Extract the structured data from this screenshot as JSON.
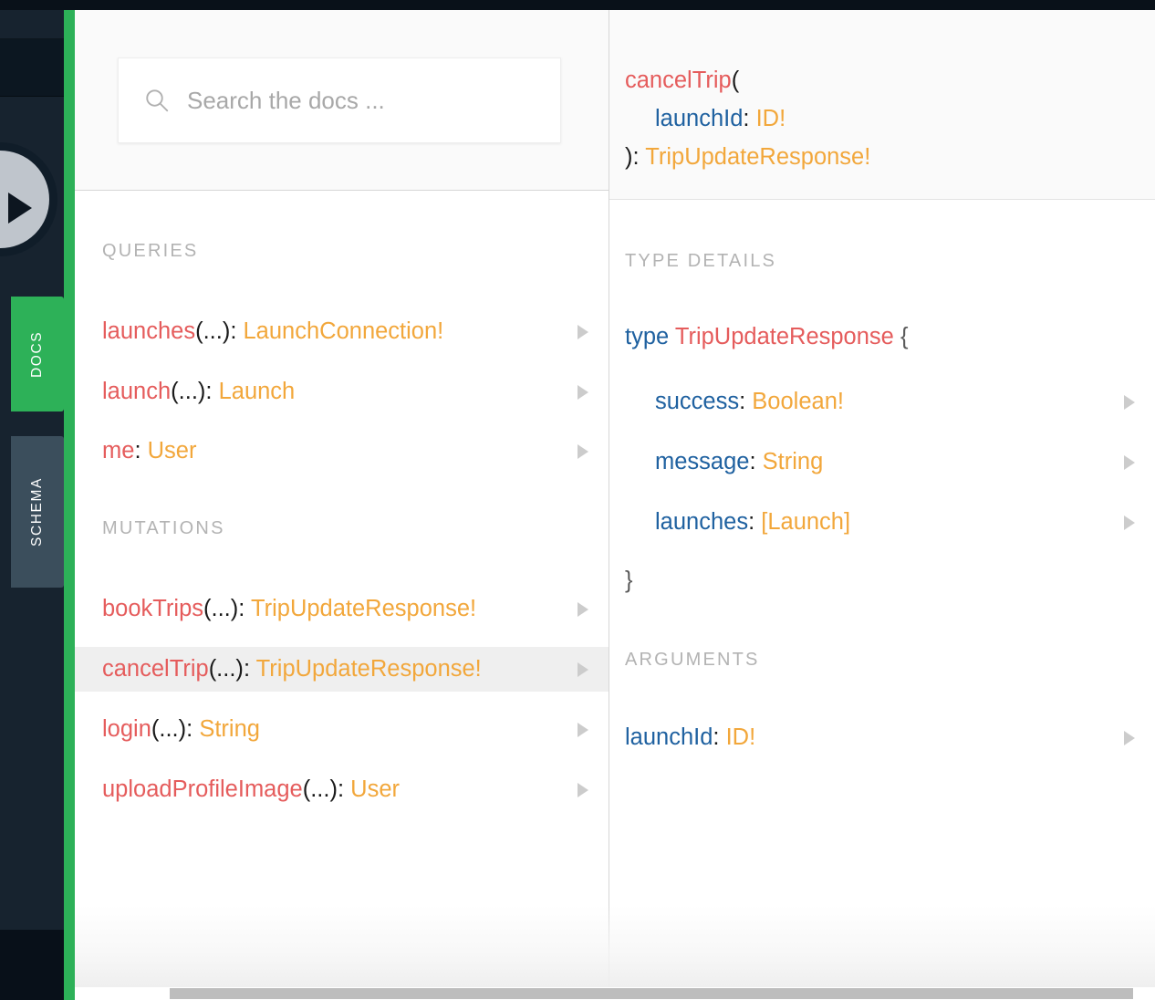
{
  "window": {
    "accent_green": "#2db158",
    "rail_dark": "#17232f",
    "selected_row_bg": "#efefef",
    "field_color": "#e55c5c",
    "type_color": "#f2a73b",
    "arg_color": "#1f61a0"
  },
  "rail": {
    "tabs": [
      {
        "label": "DOCS",
        "active": true
      },
      {
        "label": "SCHEMA",
        "active": false
      }
    ],
    "play_button_label": "play-query"
  },
  "search": {
    "placeholder": "Search the docs ...",
    "value": "",
    "icon": "search-icon"
  },
  "left_panel": {
    "sections": [
      {
        "title": "QUERIES",
        "items": [
          {
            "name": "launches",
            "args": "(...)",
            "sep": ": ",
            "type": "LaunchConnection!",
            "selected": false,
            "caret": true
          },
          {
            "name": "launch",
            "args": "(...)",
            "sep": ": ",
            "type": "Launch",
            "selected": false,
            "caret": true
          },
          {
            "name": "me",
            "args": "",
            "sep": ": ",
            "type": "User",
            "selected": false,
            "caret": true
          }
        ]
      },
      {
        "title": "MUTATIONS",
        "items": [
          {
            "name": "bookTrips",
            "args": "(...)",
            "sep": ": ",
            "type": "TripUpdateResponse!",
            "selected": false,
            "caret": true
          },
          {
            "name": "cancelTrip",
            "args": "(...)",
            "sep": ": ",
            "type": "TripUpdateResponse!",
            "selected": true,
            "caret": true
          },
          {
            "name": "login",
            "args": "(...)",
            "sep": ": ",
            "type": "String",
            "selected": false,
            "caret": true
          },
          {
            "name": "uploadProfileImage",
            "args": "(...)",
            "sep": ": ",
            "type": "User",
            "selected": false,
            "caret": true
          }
        ]
      }
    ]
  },
  "right_panel": {
    "signature": {
      "field": "cancelTrip",
      "open_paren": "(",
      "arg_name": "launchId",
      "arg_sep": ": ",
      "arg_type": "ID!",
      "close_paren": ")",
      "return_sep": ": ",
      "return_type": "TripUpdateResponse!"
    },
    "type_details": {
      "title": "TYPE DETAILS",
      "keyword": "type",
      "type_name": "TripUpdateResponse",
      "open_brace": "{",
      "close_brace": "}",
      "fields": [
        {
          "name": "success",
          "sep": ": ",
          "type": "Boolean!",
          "caret": true
        },
        {
          "name": "message",
          "sep": ": ",
          "type": "String",
          "caret": true
        },
        {
          "name": "launches",
          "sep": ": ",
          "type": "[Launch]",
          "caret": true
        }
      ]
    },
    "arguments": {
      "title": "ARGUMENTS",
      "items": [
        {
          "name": "launchId",
          "sep": ": ",
          "type": "ID!",
          "caret": true
        }
      ]
    }
  }
}
